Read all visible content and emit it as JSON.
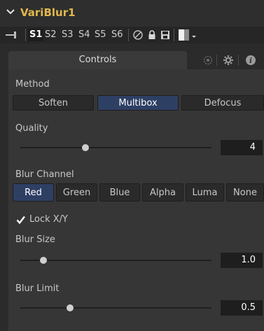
{
  "tool": {
    "title": "VariBlur1"
  },
  "toolbar": {
    "slots": [
      "S1",
      "S2",
      "S3",
      "S4",
      "S5",
      "S6"
    ],
    "active_slot": "S1"
  },
  "tabs": {
    "controls_label": "Controls"
  },
  "method": {
    "label": "Method",
    "options": [
      "Soften",
      "Multibox",
      "Defocus"
    ],
    "selected": "Multibox"
  },
  "quality": {
    "label": "Quality",
    "value": "4",
    "slider_fraction": 0.34
  },
  "blur_channel": {
    "label": "Blur Channel",
    "options": [
      "Red",
      "Green",
      "Blue",
      "Alpha",
      "Luma",
      "None"
    ],
    "selected": "Red"
  },
  "lock_xy": {
    "label": "Lock X/Y",
    "checked": true
  },
  "blur_size": {
    "label": "Blur Size",
    "value": "1.0",
    "slider_fraction": 0.12
  },
  "blur_limit": {
    "label": "Blur Limit",
    "value": "0.5",
    "slider_fraction": 0.26
  }
}
